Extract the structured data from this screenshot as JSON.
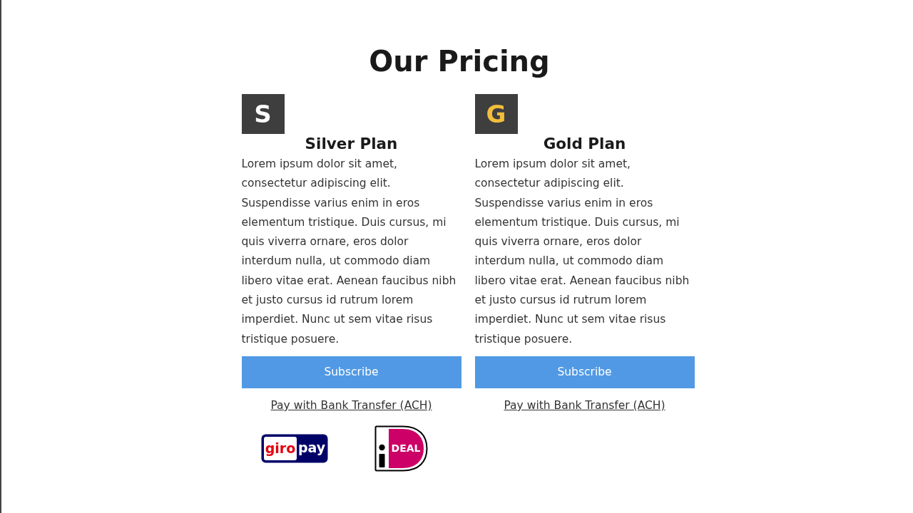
{
  "page": {
    "title": "Our Pricing"
  },
  "plans": [
    {
      "badge": {
        "letter": "S",
        "color": "#ffffff"
      },
      "name": "Silver Plan",
      "description": "Lorem ipsum dolor sit amet, consectetur adipiscing elit. Suspendisse varius enim in eros elementum tristique. Duis cursus, mi quis viverra ornare, eros dolor interdum nulla, ut commodo diam libero vitae erat. Aenean faucibus nibh et justo cursus id rutrum lorem imperdiet. Nunc ut sem vitae risus tristique posuere.",
      "button": "Subscribe",
      "link": "Pay with Bank Transfer (ACH)",
      "payment_logos": [
        {
          "kind": "giropay",
          "parts": [
            "giro",
            "pay"
          ]
        },
        {
          "kind": "ideal",
          "text": "DEAL"
        }
      ]
    },
    {
      "badge": {
        "letter": "G",
        "color": "#f2bd3c"
      },
      "name": "Gold Plan",
      "description": "Lorem ipsum dolor sit amet, consectetur adipiscing elit. Suspendisse varius enim in eros elementum tristique. Duis cursus, mi quis viverra ornare, eros dolor interdum nulla, ut commodo diam libero vitae erat. Aenean faucibus nibh et justo cursus id rutrum lorem imperdiet. Nunc ut sem vitae risus tristique posuere.",
      "button": "Subscribe",
      "link": "Pay with Bank Transfer (ACH)"
    }
  ]
}
